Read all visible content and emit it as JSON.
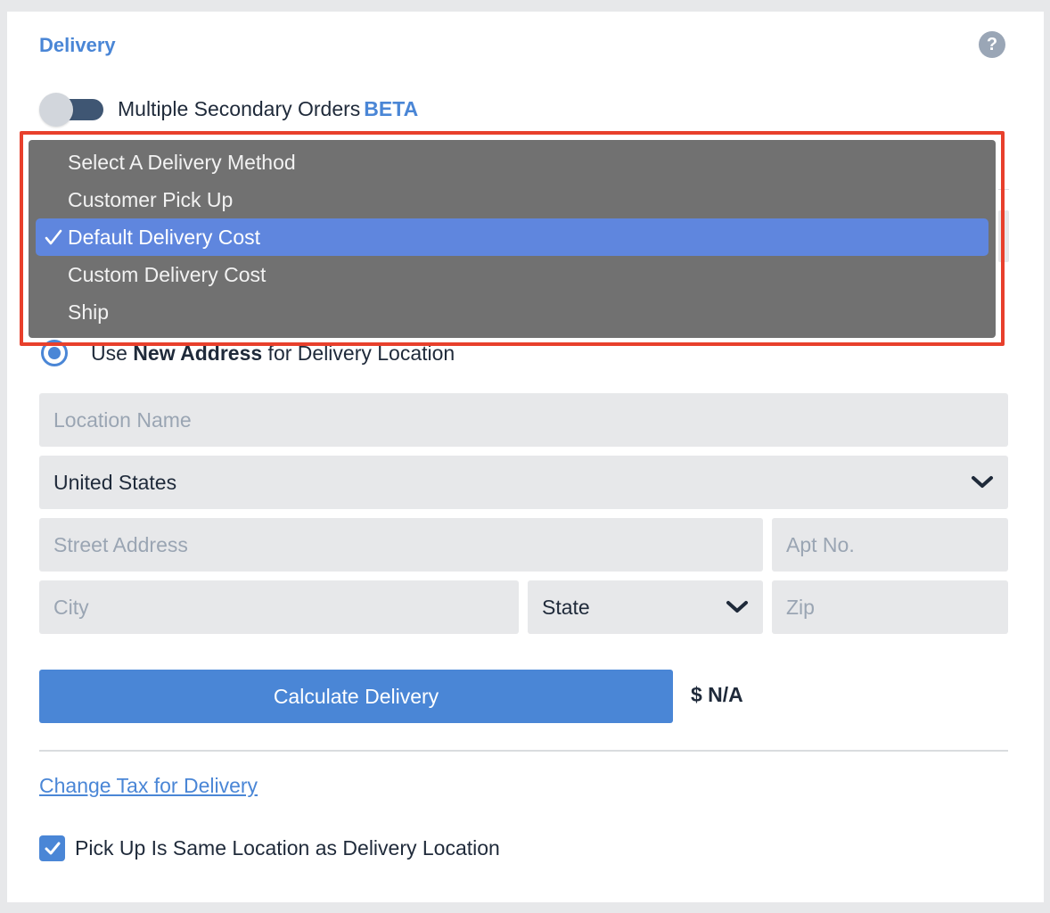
{
  "section": {
    "title": "Delivery"
  },
  "help": {
    "label": "?"
  },
  "toggle": {
    "label": "Multiple Secondary Orders",
    "beta": "BETA",
    "on": false
  },
  "delivery_method_menu": {
    "options": [
      {
        "label": "Select A Delivery Method",
        "selected": false
      },
      {
        "label": "Customer Pick Up",
        "selected": false
      },
      {
        "label": "Default Delivery Cost",
        "selected": true
      },
      {
        "label": "Custom Delivery Cost",
        "selected": false
      },
      {
        "label": "Ship",
        "selected": false
      }
    ]
  },
  "address_option": {
    "prefix": "Use ",
    "bold": "New Address",
    "suffix": " for Delivery Location",
    "selected": true
  },
  "form": {
    "location_name_placeholder": "Location Name",
    "country_value": "United States",
    "street_placeholder": "Street Address",
    "apt_placeholder": "Apt No.",
    "city_placeholder": "City",
    "state_value": "State",
    "zip_placeholder": "Zip"
  },
  "calculate_button": "Calculate Delivery",
  "price": "$ N/A",
  "tax_link": "Change Tax for Delivery",
  "pickup_checkbox": {
    "label": "Pick Up Is Same Location as Delivery Location",
    "checked": true
  },
  "colors": {
    "accent": "#4a86d6",
    "highlight": "#e8402c",
    "menu_selected": "#5f86de"
  }
}
